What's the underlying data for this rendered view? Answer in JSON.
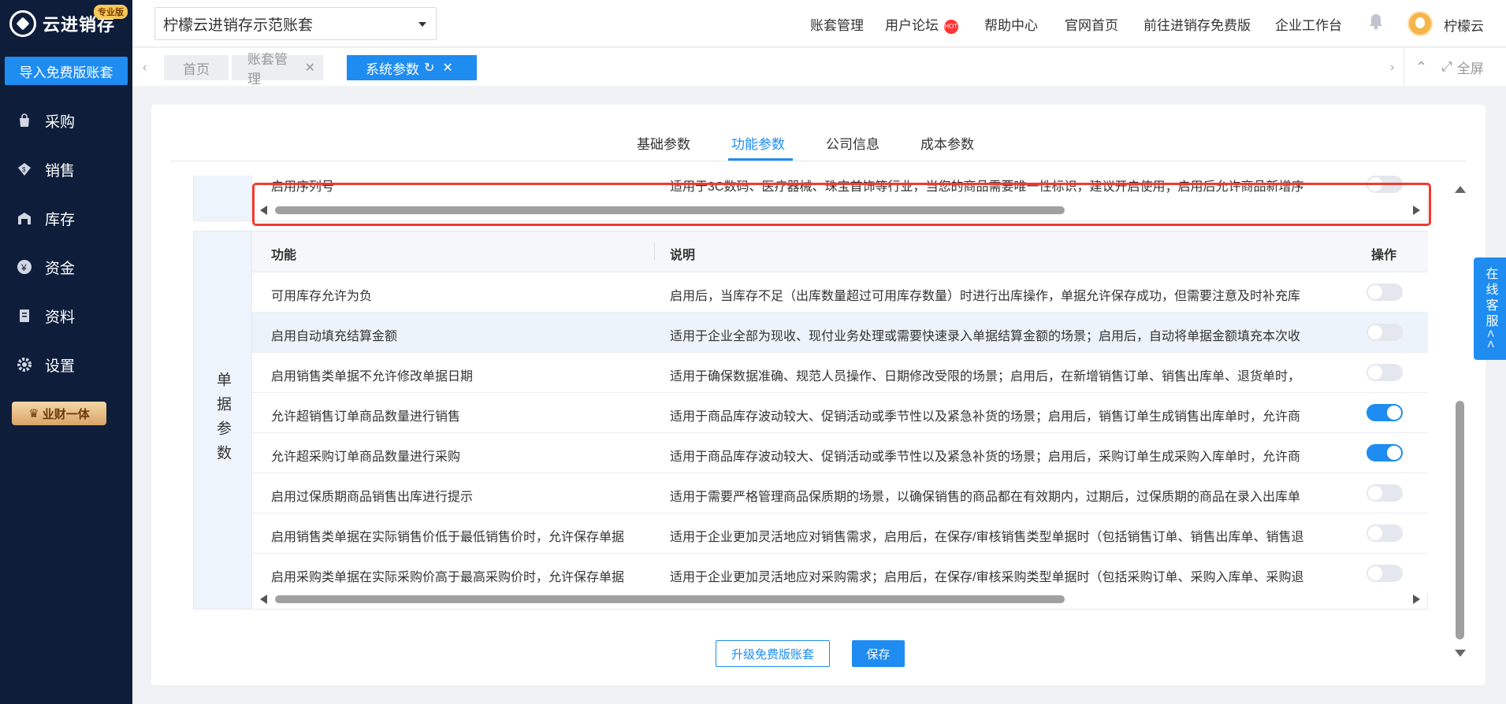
{
  "sidebar": {
    "logo_text": "云进销存",
    "edition_badge": "专业版",
    "import_button": "导入免费版账套",
    "items": [
      {
        "label": "采购",
        "icon": "bag-icon"
      },
      {
        "label": "销售",
        "icon": "sales-icon"
      },
      {
        "label": "库存",
        "icon": "warehouse-icon"
      },
      {
        "label": "资金",
        "icon": "yen-icon"
      },
      {
        "label": "资料",
        "icon": "document-icon"
      },
      {
        "label": "设置",
        "icon": "gear-icon"
      }
    ],
    "vip_badge": "业财一体"
  },
  "header": {
    "account_select": "柠檬云进销存示范账套",
    "nav": [
      "账套管理",
      "用户论坛",
      "帮助中心",
      "官网首页",
      "前往进销存免费版",
      "企业工作台"
    ],
    "hot_badge": "HOT",
    "username": "柠檬云"
  },
  "tabs": {
    "items": [
      "首页",
      "账套管理",
      "系统参数"
    ],
    "active": "系统参数",
    "fullscreen": "全屏"
  },
  "subtabs": {
    "items": [
      "基础参数",
      "功能参数",
      "公司信息",
      "成本参数"
    ],
    "active": "功能参数"
  },
  "section1": {
    "rows": [
      {
        "function": "启用序列号",
        "description": "适用于3C数码、医疗器械、珠宝首饰等行业，当您的商品需要唯一性标识，建议开启使用；启用后允许商品新增序",
        "enabled": false
      }
    ]
  },
  "section2": {
    "label": "单据参数",
    "headers": {
      "function": "功能",
      "description": "说明",
      "action": "操作"
    },
    "rows": [
      {
        "function": "可用库存允许为负",
        "description": "启用后，当库存不足（出库数量超过可用库存数量）时进行出库操作，单据允许保存成功，但需要注意及时补充库",
        "enabled": false
      },
      {
        "function": "启用自动填充结算金额",
        "description": "适用于企业全部为现收、现付业务处理或需要快速录入单据结算金额的场景；启用后，自动将单据金额填充本次收",
        "enabled": false
      },
      {
        "function": "启用销售类单据不允许修改单据日期",
        "description": "适用于确保数据准确、规范人员操作、日期修改受限的场景；启用后，在新增销售订单、销售出库单、退货单时，",
        "enabled": false
      },
      {
        "function": "允许超销售订单商品数量进行销售",
        "description": "适用于商品库存波动较大、促销活动或季节性以及紧急补货的场景；启用后，销售订单生成销售出库单时，允许商",
        "enabled": true
      },
      {
        "function": "允许超采购订单商品数量进行采购",
        "description": "适用于商品库存波动较大、促销活动或季节性以及紧急补货的场景；启用后，采购订单生成采购入库单时，允许商",
        "enabled": true
      },
      {
        "function": "启用过保质期商品销售出库进行提示",
        "description": "适用于需要严格管理商品保质期的场景，以确保销售的商品都在有效期内，过期后，过保质期的商品在录入出库单",
        "enabled": false
      },
      {
        "function": "启用销售类单据在实际销售价低于最低销售价时，允许保存单据",
        "description": "适用于企业更加灵活地应对销售需求，启用后，在保存/审核销售类型单据时（包括销售订单、销售出库单、销售退",
        "enabled": false
      },
      {
        "function": "启用采购类单据在实际采购价高于最高采购价时，允许保存单据",
        "description": "适用于企业更加灵活地应对采购需求；启用后，在保存/审核采购类型单据时（包括采购订单、采购入库单、采购退",
        "enabled": false
      }
    ]
  },
  "footer": {
    "upgrade_button": "升级免费版账套",
    "save_button": "保存"
  },
  "online_service": "在线客服<<",
  "colors": {
    "primary": "#1e8cf0",
    "sidebar_bg": "#0e1e3a",
    "highlight_border": "#f03a2e"
  }
}
